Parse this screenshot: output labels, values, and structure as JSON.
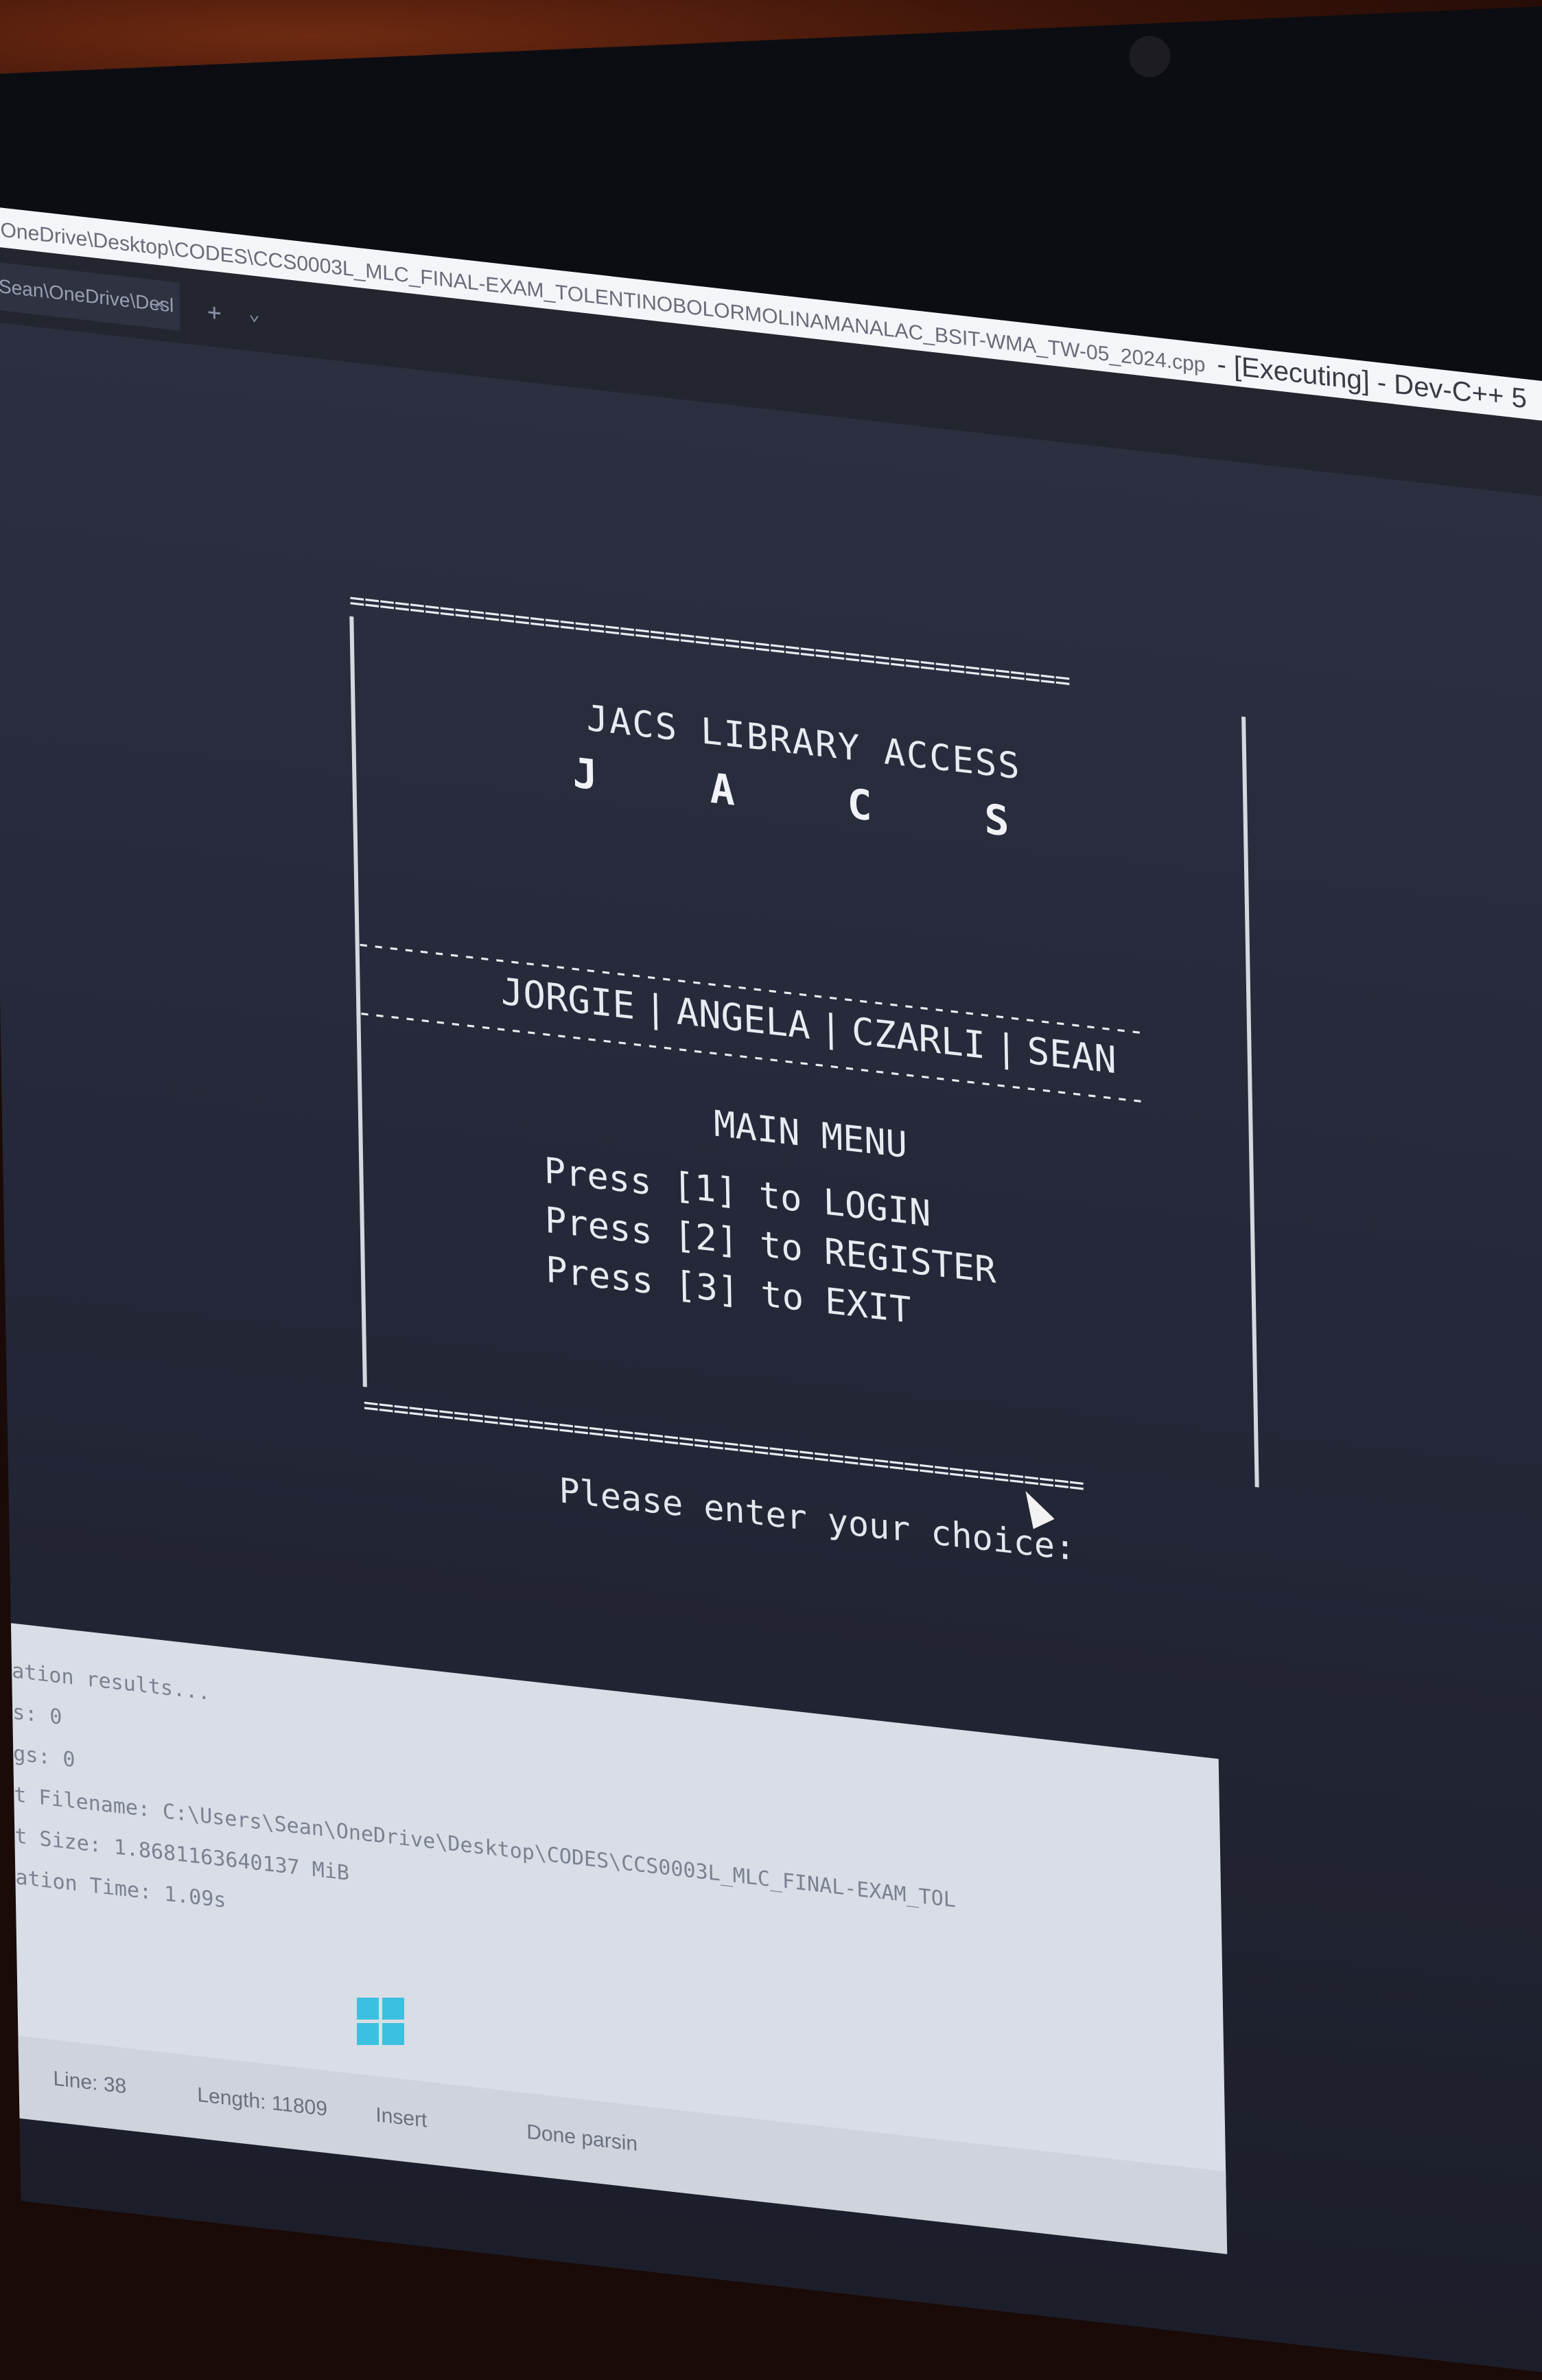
{
  "window": {
    "title_path": "OneDrive\\Desktop\\CODES\\CCS0003L_MLC_FINAL-EXAM_TOLENTINOBOLORMOLINAMANALAC_BSIT-WMA_TW-05_2024.cpp",
    "title_suffix": " - [Executing] - Dev-C++ 5"
  },
  "tabs": [
    {
      "label": "Sean\\OneDrive\\Desl"
    }
  ],
  "tab_controls": {
    "add": "+",
    "menu": "⌄",
    "close": "×"
  },
  "console": {
    "border_eq": "================================================",
    "border_dash": "----------------------------------------------------",
    "app_title": "JACS LIBRARY ACCESS",
    "ascii_logo": [
      "J",
      "A",
      "C",
      "S"
    ],
    "members": [
      "JORGIE",
      "ANGELA",
      "CZARLI",
      "SEAN"
    ],
    "member_separator": "|",
    "menu_title": "MAIN MENU",
    "options": [
      "Press [1] to LOGIN",
      "Press [2] to REGISTER",
      "Press [3] to EXIT"
    ],
    "prompt": "Please enter your choice:"
  },
  "compile_log": [
    "ation results...",
    "s: 0",
    "gs: 0",
    "t Filename: C:\\Users\\Sean\\OneDrive\\Desktop\\CODES\\CCS0003L_MLC_FINAL-EXAM_TOL",
    "t Size: 1.8681163640137 MiB",
    "ation Time: 1.09s"
  ],
  "status_bar": {
    "line": "Line: 38",
    "length": "Length: 11809",
    "mode": "Insert",
    "state": "Done parsin"
  },
  "colors": {
    "console_bg": "#2a2e3d",
    "console_text": "#e9ebf2",
    "titlebar_bg": "#f4f5f8",
    "accent": "#3cc0e0"
  }
}
